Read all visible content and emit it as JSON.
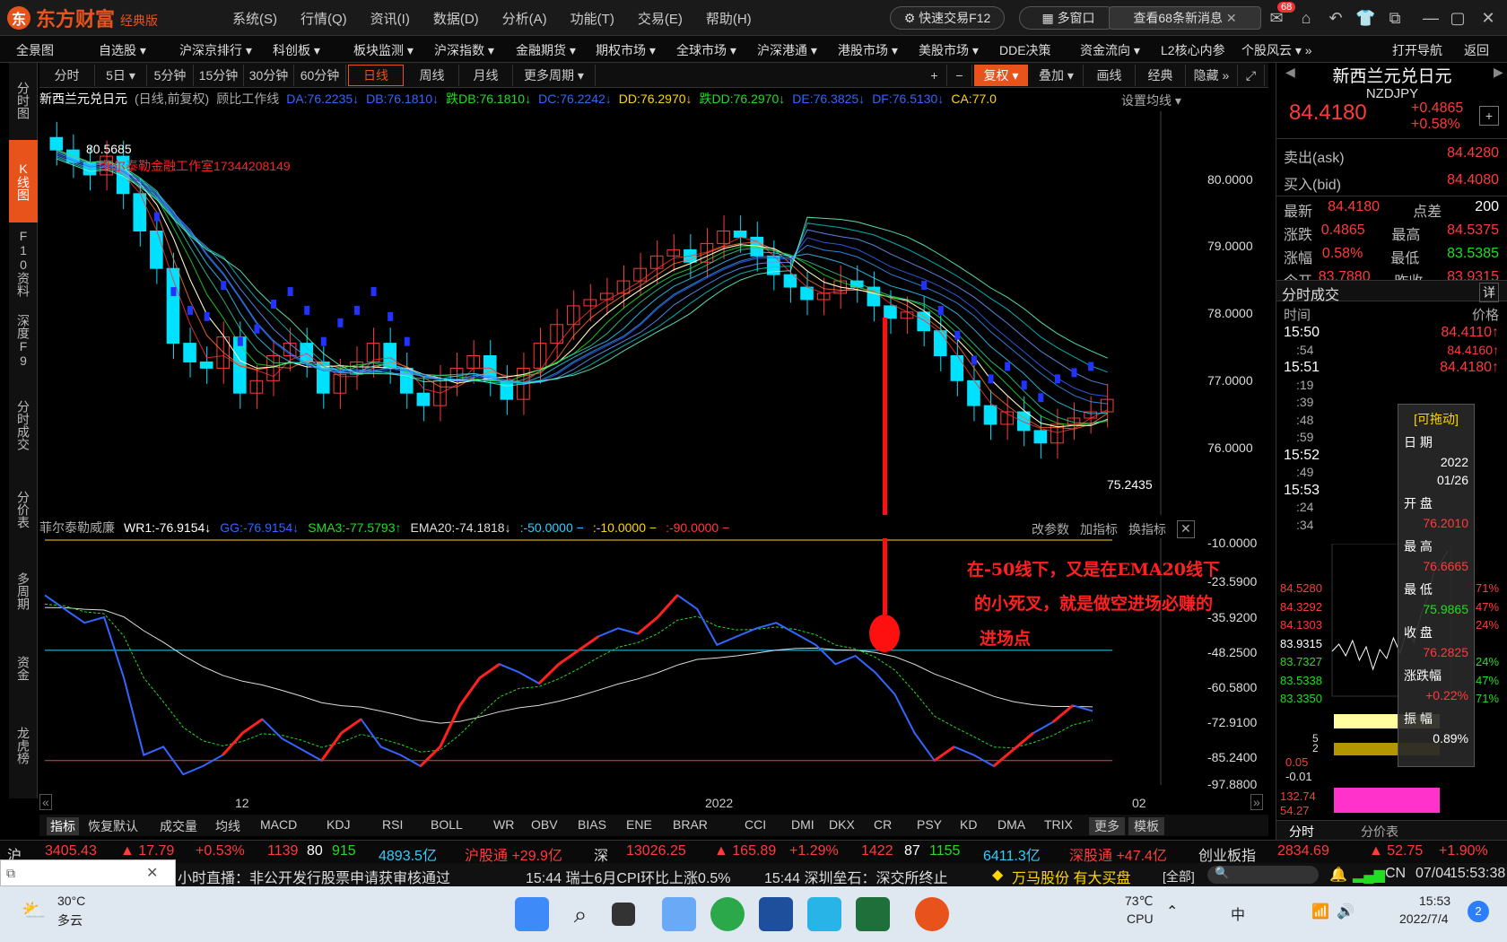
{
  "app": {
    "logo_text": "东方财富",
    "edition": "经典版",
    "menu": [
      "系统(S)",
      "行情(Q)",
      "资讯(I)",
      "数据(D)",
      "分析(A)",
      "功能(T)",
      "交易(E)",
      "帮助(H)"
    ],
    "quick_trade": "快速交易F12",
    "multi_window": "多窗口",
    "news_button": "查看68条新消息",
    "mail_badge": "68"
  },
  "nav": [
    "全景图",
    "自选股 ▾",
    "沪深京排行 ▾",
    "科创板 ▾",
    "板块监测 ▾",
    "沪深指数 ▾",
    "金融期货 ▾",
    "期权市场 ▾",
    "全球市场 ▾",
    "沪深港通 ▾",
    "港股市场 ▾",
    "美股市场 ▾",
    "DDE决策",
    "资金流向 ▾",
    "L2核心内参",
    "个股风云 ▾ »",
    "打开导航",
    "返回"
  ],
  "sidebar": [
    "分时图",
    "K线图",
    "F10资料",
    "深度F9",
    "分时成交",
    "分价表",
    "多周期",
    "资金",
    "龙虎榜"
  ],
  "periods": [
    "分时",
    "5日 ▾",
    "5分钟",
    "15分钟",
    "30分钟",
    "60分钟",
    "日线",
    "周线",
    "月线",
    "更多周期 ▾"
  ],
  "toolbar_right": [
    "+",
    "−",
    "复权 ▾",
    "叠加 ▾",
    "画线",
    "经典",
    "隐藏 »"
  ],
  "indicators": {
    "title": "新西兰元兑日元",
    "mode": "(日线,前复权)",
    "tool": "顾比工作线",
    "values": [
      {
        "label": "DA:76.2235↓",
        "color": "#3366ff"
      },
      {
        "label": "DB:76.1810↓",
        "color": "#3366ff"
      },
      {
        "label": "跌DB:76.1810↓",
        "color": "#22dd22"
      },
      {
        "label": "DC:76.2242↓",
        "color": "#3366ff"
      },
      {
        "label": "DD:76.2970↓",
        "color": "#ffd700"
      },
      {
        "label": "跌DD:76.2970↓",
        "color": "#22dd22"
      },
      {
        "label": "DE:76.3825↓",
        "color": "#3366ff"
      },
      {
        "label": "DF:76.5130↓",
        "color": "#3366ff"
      },
      {
        "label": "CA:77.0",
        "color": "#ffd700"
      }
    ],
    "set_ma": "设置均线 ▾"
  },
  "main_chart": {
    "y_ticks": [
      "80.0000",
      "79.0000",
      "78.0000",
      "77.0000",
      "76.0000"
    ],
    "high_label": "80.5685",
    "low_label": "75.2435",
    "watermark": "菲尔泰勒金融工作室17344208149"
  },
  "sub_chart": {
    "name": "菲尔泰勒威廉",
    "values": [
      {
        "label": "WR1:-76.9154↓",
        "color": "#ffffff"
      },
      {
        "label": "GG:-76.9154↓",
        "color": "#3366ff"
      },
      {
        "label": "SMA3:-77.5793↑",
        "color": "#22dd22"
      },
      {
        "label": "EMA20:-74.1818↓",
        "color": "#dddddd"
      },
      {
        "label": ":-50.0000 −",
        "color": "#33ccff"
      },
      {
        "label": ":-10.0000 −",
        "color": "#ffd700"
      },
      {
        "label": ":-90.0000 −",
        "color": "#ff3b3b"
      }
    ],
    "actions": [
      "改参数",
      "加指标",
      "换指标"
    ],
    "y_ticks": [
      "-10.0000",
      "-23.5900",
      "-35.9200",
      "-48.2500",
      "-60.5800",
      "-72.9100",
      "-85.2400",
      "-97.8800"
    ],
    "annotation_lines": [
      "在-50线下，又是在EMA20线下",
      "的小死叉，就是做空进场必赚的",
      "进场点"
    ]
  },
  "x_axis": [
    "12",
    "2022",
    "02"
  ],
  "indicator_tabs": [
    "指标",
    "恢复默认",
    "成交量",
    "均线",
    "MACD",
    "KDJ",
    "RSI",
    "BOLL",
    "WR",
    "OBV",
    "BIAS",
    "ENE",
    "BRAR",
    "CCI",
    "DMI",
    "DKX",
    "CR",
    "PSY",
    "KD",
    "DMA",
    "TRIX",
    "更多",
    "模板"
  ],
  "quote": {
    "name": "新西兰元兑日元",
    "code": "NZDJPY",
    "price": "84.4180",
    "change": "+0.4865",
    "change_pct": "+0.58%",
    "ask_label": "卖出(ask)",
    "ask": "84.4280",
    "bid_label": "买入(bid)",
    "bid": "84.4080",
    "rows": [
      [
        "最新",
        "84.4180",
        "点差",
        "200"
      ],
      [
        "涨跌",
        "0.4865",
        "最高",
        "84.5375"
      ],
      [
        "涨幅",
        "0.58%",
        "最低",
        "83.5385"
      ],
      [
        "今开",
        "83.7880",
        "昨收",
        "83.9315"
      ]
    ],
    "ticks_title": "分时成交",
    "ticks_detail": "详",
    "ticks_header": [
      "时间",
      "价格"
    ],
    "ticks": [
      [
        "15:50",
        "84.4110↑"
      ],
      [
        ":54",
        "84.4160↑"
      ],
      [
        "15:51",
        "84.4180↑"
      ],
      [
        ":19",
        ""
      ],
      [
        ":39",
        ""
      ],
      [
        ":48",
        ""
      ],
      [
        ":59",
        ""
      ],
      [
        "15:52",
        ""
      ],
      [
        ":49",
        ""
      ],
      [
        "15:53",
        ""
      ],
      [
        ":24",
        ""
      ],
      [
        ":34",
        ""
      ]
    ],
    "mini_prices": [
      "84.5280",
      "84.3292",
      "84.1303",
      "83.9315",
      "83.7327",
      "83.5338",
      "83.3350"
    ],
    "mini_pcts": [
      "71%",
      "47%",
      "24%",
      "",
      "24%",
      "47%",
      "71%"
    ],
    "mini_vol": [
      "5",
      "2"
    ],
    "mini_ind": [
      "0.05",
      "-0.01",
      "132.74",
      "54.27"
    ],
    "bottom_tabs": [
      "分时",
      "分价表"
    ]
  },
  "popup": {
    "title": "[可拖动]",
    "rows": [
      [
        "日 期",
        "2022",
        "01/26"
      ],
      [
        "开 盘",
        "76.2010"
      ],
      [
        "最 高",
        "76.6665"
      ],
      [
        "最 低",
        "75.9865"
      ],
      [
        "收 盘",
        "76.2825"
      ],
      [
        "涨跌幅",
        "+0.22%"
      ],
      [
        "振 幅",
        "0.89%"
      ]
    ]
  },
  "status": {
    "sh_label": "沪",
    "sh_index": "3405.43",
    "sh_chg": "▲ 17.79",
    "sh_pct": "+0.53%",
    "sh_a": "1139",
    "sh_b": "80",
    "sh_c": "915",
    "sh_amt": "4893.5亿",
    "hgt": "沪股通 +29.9亿",
    "sz_label": "深",
    "sz_index": "13026.25",
    "sz_chg": "▲ 165.89",
    "sz_pct": "+1.29%",
    "sz_a": "1422",
    "sz_b": "87",
    "sz_c": "1155",
    "sz_amt": "6411.3亿",
    "sgt": "深股通 +47.4亿",
    "cyb": "创业板指",
    "cyb_index": "2834.69",
    "cyb_chg": "▲ 52.75",
    "cyb_pct": "+1.90%"
  },
  "news": {
    "items": [
      "小时直播：非公开发行股票申请获审核通过",
      "15:44  瑞士6月CPI环比上涨0.5%",
      "15:44  深圳垒石：深交所终止"
    ],
    "stock": "万马股份 有大买盘",
    "all": "[全部]",
    "region": "CN",
    "date": "07/04",
    "time": "15:53:38"
  },
  "taskbar": {
    "weather_temp": "30°C",
    "weather_desc": "多云",
    "cpu_temp": "73℃",
    "cpu_label": "CPU",
    "clock_time": "15:53",
    "clock_date": "2022/7/4",
    "notif": "2"
  }
}
